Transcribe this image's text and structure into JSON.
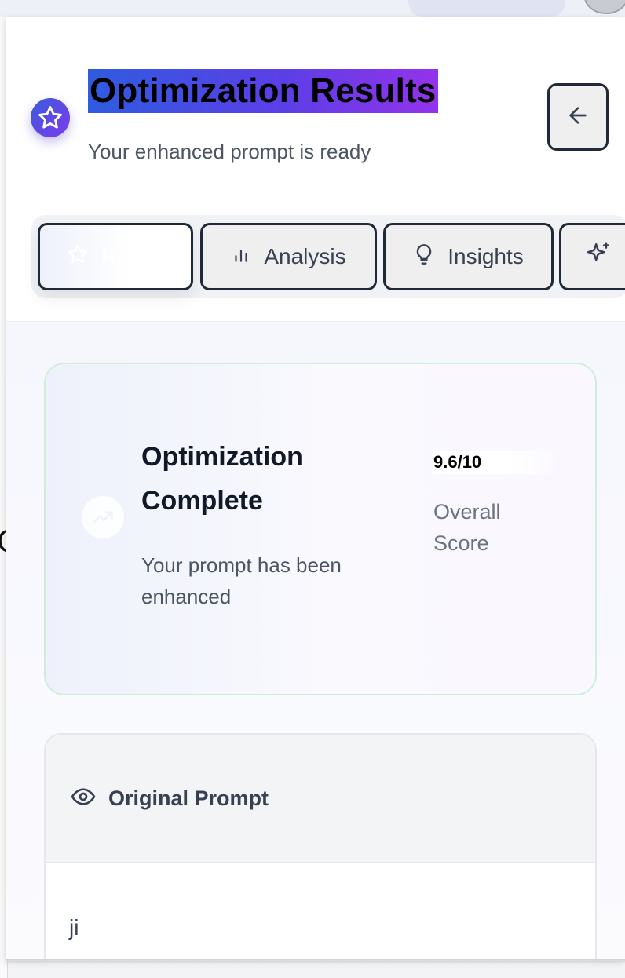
{
  "header": {
    "title": "Optimization Results",
    "subtitle": "Your enhanced prompt is ready",
    "logo_icon": "star-icon",
    "back_icon": "arrow-left-icon"
  },
  "tabs": [
    {
      "label": "Result",
      "icon": "star-icon",
      "active": true
    },
    {
      "label": "Analysis",
      "icon": "bar-chart-icon",
      "active": false
    },
    {
      "label": "Insights",
      "icon": "lightbulb-icon",
      "active": false
    },
    {
      "label": "",
      "icon": "sparkles-icon",
      "active": false
    }
  ],
  "summary": {
    "title": "Optimization Complete",
    "description": "Your prompt has been enhanced",
    "score": "9.6/10",
    "score_label": "Overall Score",
    "icon": "trending-up-icon"
  },
  "original": {
    "title": "Original Prompt",
    "icon": "eye-icon",
    "text": "ji"
  },
  "colors": {
    "accent_start": "#2f5be0",
    "accent_end": "#9333ea",
    "success_border": "#ccefd8"
  }
}
